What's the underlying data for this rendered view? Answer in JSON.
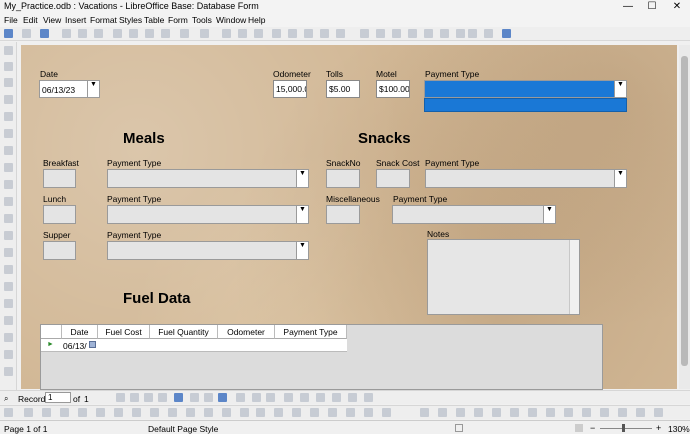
{
  "window": {
    "title": "My_Practice.odb : Vacations - LibreOffice Base: Database Form",
    "minimize": "—",
    "maximize": "☐",
    "close": "✕"
  },
  "menu": [
    "File",
    "Edit",
    "View",
    "Insert",
    "Format",
    "Styles",
    "Table",
    "Form",
    "Tools",
    "Window",
    "Help"
  ],
  "form": {
    "date_label": "Date",
    "date_value": "06/13/23",
    "odometer_label": "Odometer",
    "odometer_value": "15,000.0",
    "tolls_label": "Tolls",
    "tolls_value": "$5.00",
    "motel_label": "Motel",
    "motel_value": "$100.00",
    "payment_type_label": "Payment Type",
    "meals_heading": "Meals",
    "snacks_heading": "Snacks",
    "fuel_heading": "Fuel Data",
    "breakfast_label": "Breakfast",
    "lunch_label": "Lunch",
    "supper_label": "Supper",
    "snackno_label": "SnackNo",
    "snack_cost_label": "Snack Cost",
    "misc_label": "Miscellaneous",
    "notes_label": "Notes"
  },
  "fuel_grid": {
    "columns": [
      "Date",
      "Fuel Cost",
      "Fuel Quantity",
      "Odometer",
      "Payment Type"
    ],
    "row_date": "06/13/"
  },
  "nav": {
    "record_label": "Record",
    "record_value": "1",
    "of_label": "of",
    "total": "1"
  },
  "status": {
    "page": "Page 1 of 1",
    "style": "Default Page Style",
    "zoom": "130%"
  },
  "colors": {
    "selected": "#1a78d6",
    "background": "#d2b896"
  }
}
